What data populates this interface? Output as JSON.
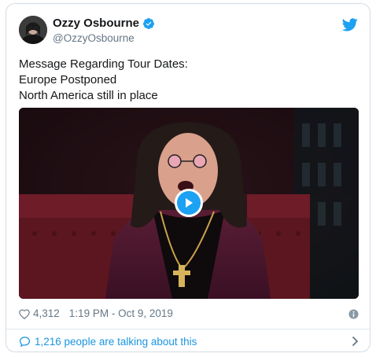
{
  "author": {
    "display_name": "Ozzy Osbourne",
    "handle": "@OzzyOsbourne",
    "verified": true
  },
  "tweet": {
    "lines": [
      "Message Regarding Tour Dates:",
      "Europe Postponed",
      "North America still in place"
    ]
  },
  "media": {
    "type": "video",
    "play_icon": "play-icon"
  },
  "meta": {
    "like_count": "4,312",
    "timestamp": "1:19 PM - Oct 9, 2019"
  },
  "footer": {
    "talking_text": "1,216 people are talking about this"
  },
  "colors": {
    "accent": "#1da1f2",
    "link": "#1b95e0",
    "muted": "#657786",
    "border": "#d3dce3"
  },
  "icons": [
    "twitter-bird-icon",
    "verified-badge-icon",
    "heart-icon",
    "info-icon",
    "speech-bubble-icon",
    "chevron-right-icon"
  ]
}
